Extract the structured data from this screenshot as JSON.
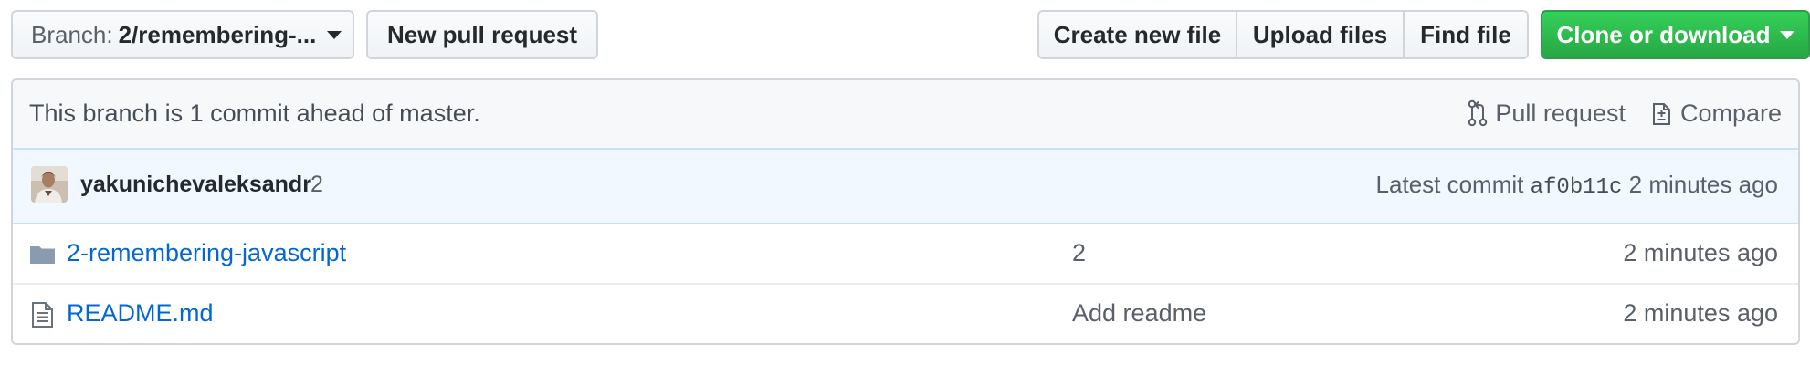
{
  "toolbar": {
    "branch_prefix": "Branch:",
    "branch_name": "2/remembering-...",
    "new_pull_request": "New pull request",
    "create_new_file": "Create new file",
    "upload_files": "Upload files",
    "find_file": "Find file",
    "clone_or_download": "Clone or download"
  },
  "branch_info": {
    "text": "This branch is 1 commit ahead of master.",
    "pull_request": "Pull request",
    "compare": "Compare"
  },
  "commit": {
    "author": "yakunichevaleksandr",
    "message": "2",
    "latest_label": "Latest commit",
    "sha": "af0b11c",
    "age": "2 minutes ago"
  },
  "files": [
    {
      "icon": "folder-icon",
      "name": "2-remembering-javascript",
      "message": "2",
      "age": "2 minutes ago"
    },
    {
      "icon": "file-text-icon",
      "name": "README.md",
      "message": "Add readme",
      "age": "2 minutes ago"
    }
  ],
  "colors": {
    "link": "#0366d6",
    "clone_button": "#28a745",
    "commit_bar": "#f1f8ff",
    "muted_text": "#586069"
  }
}
